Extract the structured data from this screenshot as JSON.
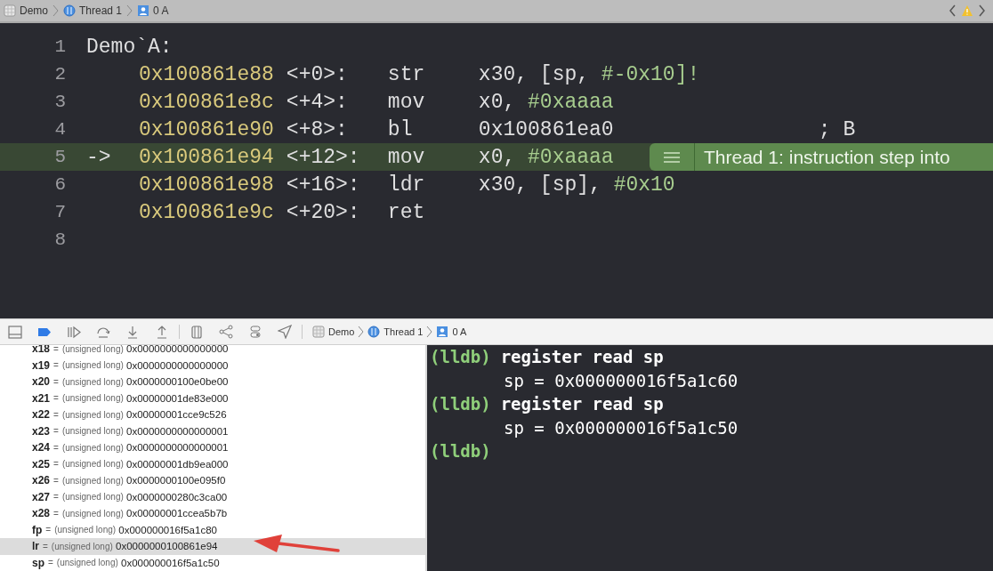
{
  "jump_bar": {
    "crumbs": [
      {
        "label": "Demo",
        "kind": "project"
      },
      {
        "label": "Thread 1",
        "kind": "thread"
      },
      {
        "label": "0 A",
        "kind": "frame"
      }
    ],
    "has_warning": true
  },
  "editor": {
    "lines": [
      {
        "number": "1",
        "current": false,
        "segments": [
          {
            "kind": "label",
            "text": "Demo`A:"
          }
        ]
      },
      {
        "number": "2",
        "current": false,
        "segments": [
          {
            "kind": "address",
            "text": "0x100861e88"
          },
          {
            "kind": "offset",
            "text": "<+0>:"
          },
          {
            "kind": "mnemonic",
            "text": "str"
          },
          {
            "kind": "operand",
            "text": "x30, [sp, "
          },
          {
            "kind": "immediate",
            "text": "#-0x10]!"
          }
        ]
      },
      {
        "number": "3",
        "current": false,
        "segments": [
          {
            "kind": "address",
            "text": "0x100861e8c"
          },
          {
            "kind": "offset",
            "text": "<+4>:"
          },
          {
            "kind": "mnemonic",
            "text": "mov"
          },
          {
            "kind": "operand",
            "text": "x0, "
          },
          {
            "kind": "immediate",
            "text": "#0xaaaa"
          }
        ]
      },
      {
        "number": "4",
        "current": false,
        "segments": [
          {
            "kind": "address",
            "text": "0x100861e90"
          },
          {
            "kind": "offset",
            "text": "<+8>:"
          },
          {
            "kind": "mnemonic",
            "text": "bl"
          },
          {
            "kind": "address_operand",
            "text": "0x100861ea0"
          },
          {
            "kind": "comment",
            "text": "; B"
          }
        ]
      },
      {
        "number": "5",
        "current": true,
        "badge": {
          "text": "Thread 1: instruction step into"
        },
        "segments": [
          {
            "kind": "arrow",
            "text": "->"
          },
          {
            "kind": "address",
            "text": "0x100861e94"
          },
          {
            "kind": "offset",
            "text": "<+12>:"
          },
          {
            "kind": "mnemonic",
            "text": "mov"
          },
          {
            "kind": "operand",
            "text": "x0, "
          },
          {
            "kind": "immediate",
            "text": "#0xaaaa"
          }
        ]
      },
      {
        "number": "6",
        "current": false,
        "segments": [
          {
            "kind": "address",
            "text": "0x100861e98"
          },
          {
            "kind": "offset",
            "text": "<+16>:"
          },
          {
            "kind": "mnemonic",
            "text": "ldr"
          },
          {
            "kind": "operand",
            "text": "x30, [sp], "
          },
          {
            "kind": "immediate",
            "text": "#0x10"
          }
        ]
      },
      {
        "number": "7",
        "current": false,
        "segments": [
          {
            "kind": "address",
            "text": "0x100861e9c"
          },
          {
            "kind": "offset",
            "text": "<+20>:"
          },
          {
            "kind": "mnemonic",
            "text": "ret"
          }
        ]
      },
      {
        "number": "8",
        "current": false
      }
    ]
  },
  "debug_bar": {
    "breakpoints_active": true,
    "crumbs": [
      {
        "label": "Demo",
        "kind": "project"
      },
      {
        "label": "Thread 1",
        "kind": "thread"
      },
      {
        "label": "0 A",
        "kind": "frame"
      }
    ]
  },
  "variables": [
    {
      "name": "x18",
      "equals": "=",
      "type": "(unsigned long)",
      "value": "0x0000000000000000",
      "selected": false
    },
    {
      "name": "x19",
      "equals": "=",
      "type": "(unsigned long)",
      "value": "0x0000000000000000",
      "selected": false
    },
    {
      "name": "x20",
      "equals": "=",
      "type": "(unsigned long)",
      "value": "0x0000000100e0be00",
      "selected": false
    },
    {
      "name": "x21",
      "equals": "=",
      "type": "(unsigned long)",
      "value": "0x00000001de83e000",
      "selected": false
    },
    {
      "name": "x22",
      "equals": "=",
      "type": "(unsigned long)",
      "value": "0x00000001cce9c526",
      "selected": false
    },
    {
      "name": "x23",
      "equals": "=",
      "type": "(unsigned long)",
      "value": "0x0000000000000001",
      "selected": false
    },
    {
      "name": "x24",
      "equals": "=",
      "type": "(unsigned long)",
      "value": "0x0000000000000001",
      "selected": false
    },
    {
      "name": "x25",
      "equals": "=",
      "type": "(unsigned long)",
      "value": "0x00000001db9ea000",
      "selected": false
    },
    {
      "name": "x26",
      "equals": "=",
      "type": "(unsigned long)",
      "value": "0x0000000100e095f0",
      "selected": false
    },
    {
      "name": "x27",
      "equals": "=",
      "type": "(unsigned long)",
      "value": "0x0000000280c3ca00",
      "selected": false
    },
    {
      "name": "x28",
      "equals": "=",
      "type": "(unsigned long)",
      "value": "0x00000001ccea5b7b",
      "selected": false
    },
    {
      "name": "fp",
      "equals": "=",
      "type": "(unsigned long)",
      "value": "0x000000016f5a1c80",
      "selected": false
    },
    {
      "name": "lr",
      "equals": "=",
      "type": "(unsigned long)",
      "value": "0x0000000100861e94",
      "selected": true
    },
    {
      "name": "sp",
      "equals": "=",
      "type": "(unsigned long)",
      "value": "0x000000016f5a1c50",
      "selected": false
    }
  ],
  "console": [
    {
      "kind": "command",
      "prompt": "(lldb)",
      "text": "register read sp"
    },
    {
      "kind": "output",
      "text": "sp = 0x000000016f5a1c60"
    },
    {
      "kind": "command",
      "prompt": "(lldb)",
      "text": "register read sp"
    },
    {
      "kind": "output",
      "text": "sp = 0x000000016f5a1c50"
    },
    {
      "kind": "command",
      "prompt": "(lldb)"
    }
  ]
}
